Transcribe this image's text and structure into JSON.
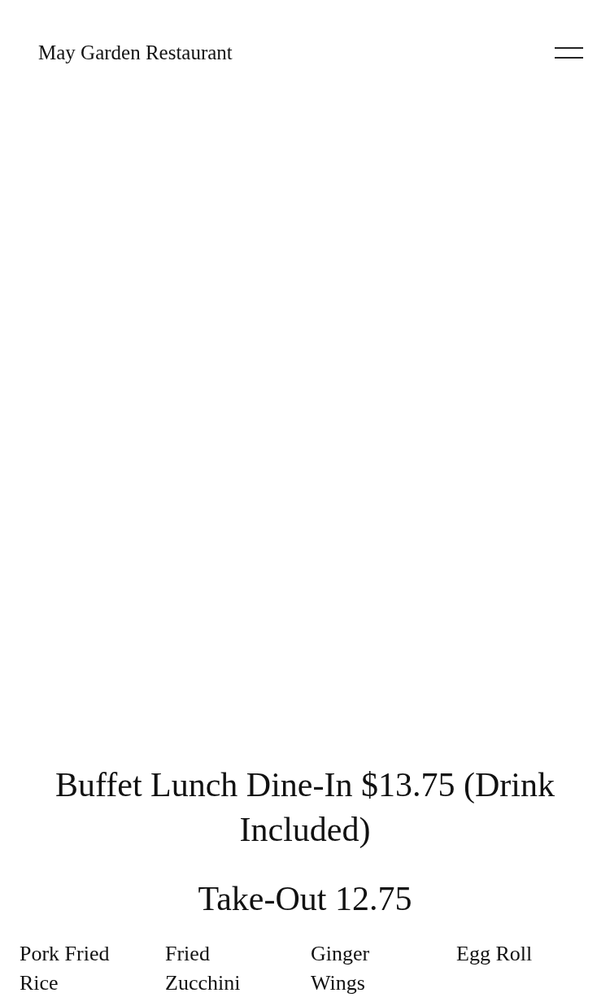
{
  "header": {
    "title": "May Garden Restaurant"
  },
  "menu": {
    "heading": "Buffet Lunch Dine-In $13.75 (Drink Included)",
    "subheading": "Take-Out 12.75",
    "items": [
      "Pork Fried Rice",
      "Fried Zucchini",
      "Ginger Wings",
      "Egg Roll"
    ]
  }
}
